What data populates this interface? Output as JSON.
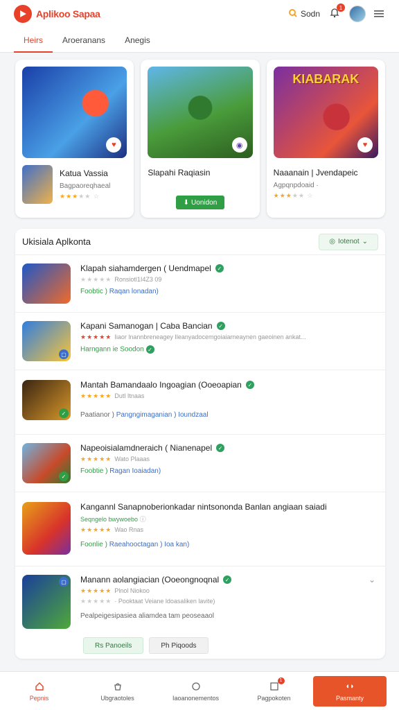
{
  "header": {
    "brand": "Aplikoo Sapaa",
    "search_label": "Sodn",
    "notification_count": "1",
    "accent": "#e8412a"
  },
  "tabs": [
    {
      "label": "Heirs",
      "active": true
    },
    {
      "label": "Aroeranans"
    },
    {
      "label": "Anegis"
    }
  ],
  "featured": [
    {
      "app_name": "Katua Vassia",
      "subtitle": "Bagpaoreqhaeal",
      "rating": 3
    },
    {
      "app_name": "Slapahi Raqiasin",
      "button": "Uonidon"
    },
    {
      "art_title": "KIABARAK",
      "app_name": "Naaanain | Jvendapeic",
      "subtitle": "Agpqnpdoaid ·",
      "rating": 3
    }
  ],
  "list": {
    "title": "Ukisiala Aplkonta",
    "filter_label": "Iotenot",
    "items": [
      {
        "name": "Klapah siahamdergen ( Uendmapel",
        "meta": "Ronsiotl1I4Z3 09",
        "extra_a": "Foobtic )",
        "extra_b": "Raqan lonadan)"
      },
      {
        "name": "Kapani Samanogan | Caba Bancian",
        "meta": "Iiaor lnannbreneagey Ileanyadocemgoiaiarneaynen gaeoinen ankat...",
        "extra_a": "Harngann ie Soodon"
      },
      {
        "name": "Mantah Bamandaalo Ingoagian (Ooeoapian",
        "meta": "Dutl Itnaas",
        "extra_a": "Paatianor )",
        "extra_b": "Pangngimaganian ) Ioundzaal"
      },
      {
        "name": "Napeoisialamdneraich ( Nianenapel",
        "meta": "Wato Plaaas",
        "extra_a": "Foobtie )",
        "extra_b": "Ragan Ioaiadan)"
      },
      {
        "name": "Kangannl Sanapnoberionkadar nintsononda Banlan angiaan saiadi",
        "sub": "Seqngelo bwywoebo",
        "meta": "Wao Rnas",
        "extra_a": "Foonlie )",
        "extra_b": "Raeahooctagan ) Ioa kan)"
      },
      {
        "name": "Manann aolangiacian (Ooeongnoqnal",
        "meta": "Plnol Niokoo",
        "meta2": "· Pooktaat Veiane ldoasaliken lavite)",
        "desc": "Pealpeigesipasiea aliamdea tam peoseaaol",
        "btn_a": "Rs Panoeils",
        "btn_b": "Ph Piqoods"
      }
    ]
  },
  "bottom_nav": [
    {
      "label": "Pepnis",
      "active": true
    },
    {
      "label": "Ubgraotoles"
    },
    {
      "label": "Iaoanonementos"
    },
    {
      "label": "Pagpokoten",
      "count": "1"
    },
    {
      "label": "Pasmanty",
      "cta": true
    }
  ]
}
